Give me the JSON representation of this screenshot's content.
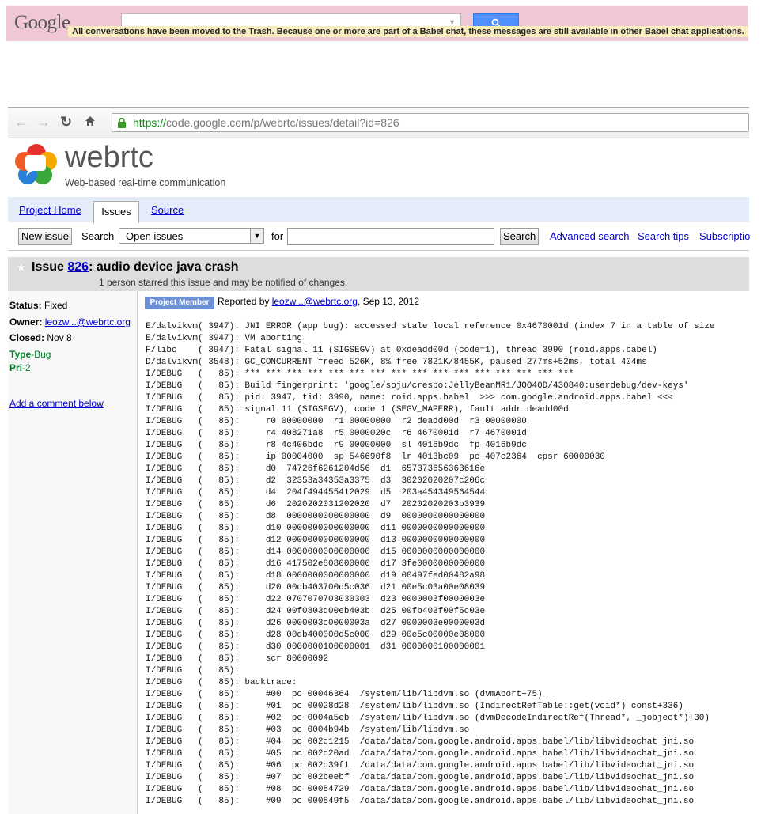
{
  "gmail": {
    "logo": "Google",
    "notice": "All conversations have been moved to the Trash. Because one or more are part of a Babel chat, these messages are still available in other Babel chat applications."
  },
  "browser": {
    "url_scheme": "https://",
    "url_rest": "code.google.com/p/webrtc/issues/detail?id=826"
  },
  "project": {
    "name": "webrtc",
    "summary": "Web-based real-time communication"
  },
  "tabs": [
    "Project Home",
    "Issues",
    "Source"
  ],
  "toolbar": {
    "new_issue": "New issue",
    "search_label": "Search",
    "select_value": "Open issues",
    "for_label": "for",
    "search_button": "Search",
    "advanced": "Advanced search",
    "tips": "Search tips",
    "subscriptions": "Subscriptio"
  },
  "issue": {
    "prefix": "Issue ",
    "number": "826",
    "title": ": audio device java crash",
    "stars_note": "1 person starred this issue and may be notified of changes."
  },
  "meta": {
    "status_label": "Status:",
    "status_value": "Fixed",
    "owner_label": "Owner:",
    "owner_value": "leozw...@webrtc.org",
    "closed_label": "Closed:",
    "closed_value": "Nov 8",
    "type_label": "Type",
    "type_value": "-Bug",
    "pri_label": "Pri",
    "pri_value": "-2",
    "add_comment": "Add a comment below"
  },
  "comment": {
    "badge": "Project Member",
    "reported_by": "Reported by ",
    "author": "leozw...@webrtc.org",
    "date": ", Sep 13, 2012"
  },
  "log_lines": [
    "E/dalvikvm( 3947): JNI ERROR (app bug): accessed stale local reference 0x4670001d (index 7 in a table of size",
    "E/dalvikvm( 3947): VM aborting",
    "F/libc    ( 3947): Fatal signal 11 (SIGSEGV) at 0xdeadd00d (code=1), thread 3990 (roid.apps.babel)",
    "D/dalvikvm( 3548): GC_CONCURRENT freed 526K, 8% free 7821K/8455K, paused 277ms+52ms, total 404ms",
    "I/DEBUG   (   85): *** *** *** *** *** *** *** *** *** *** *** *** *** *** *** ***",
    "I/DEBUG   (   85): Build fingerprint: 'google/soju/crespo:JellyBeanMR1/JOO40D/430840:userdebug/dev-keys'",
    "I/DEBUG   (   85): pid: 3947, tid: 3990, name: roid.apps.babel  >>> com.google.android.apps.babel <<<",
    "I/DEBUG   (   85): signal 11 (SIGSEGV), code 1 (SEGV_MAPERR), fault addr deadd00d",
    "I/DEBUG   (   85):     r0 00000000  r1 00000000  r2 deadd00d  r3 00000000",
    "I/DEBUG   (   85):     r4 408271a8  r5 0000020c  r6 4670001d  r7 4670001d",
    "I/DEBUG   (   85):     r8 4c406bdc  r9 00000000  sl 4016b9dc  fp 4016b9dc",
    "I/DEBUG   (   85):     ip 00004000  sp 546690f8  lr 4013bc09  pc 407c2364  cpsr 60000030",
    "I/DEBUG   (   85):     d0  74726f6261204d56  d1  657373656363616e",
    "I/DEBUG   (   85):     d2  32353a34353a3375  d3  30202020207c206c",
    "I/DEBUG   (   85):     d4  204f494455412029  d5  203a454349564544",
    "I/DEBUG   (   85):     d6  2020202031202020  d7  20202020203b3939",
    "I/DEBUG   (   85):     d8  0000000000000000  d9  0000000000000000",
    "I/DEBUG   (   85):     d10 0000000000000000  d11 0000000000000000",
    "I/DEBUG   (   85):     d12 0000000000000000  d13 0000000000000000",
    "I/DEBUG   (   85):     d14 0000000000000000  d15 0000000000000000",
    "I/DEBUG   (   85):     d16 417502e808000000  d17 3fe0000000000000",
    "I/DEBUG   (   85):     d18 0000000000000000  d19 00497fed00482a98",
    "I/DEBUG   (   85):     d20 00db403700d5c036  d21 00e5c03a00e08039",
    "I/DEBUG   (   85):     d22 0707070703030303  d23 0000003f0000003e",
    "I/DEBUG   (   85):     d24 00f0803d00eb403b  d25 00fb403f00f5c03e",
    "I/DEBUG   (   85):     d26 0000003c0000003a  d27 0000003e0000003d",
    "I/DEBUG   (   85):     d28 00db400000d5c000  d29 00e5c00000e08000",
    "I/DEBUG   (   85):     d30 0000000100000001  d31 0000000100000001",
    "I/DEBUG   (   85):     scr 80000092",
    "I/DEBUG   (   85):",
    "I/DEBUG   (   85): backtrace:",
    "I/DEBUG   (   85):     #00  pc 00046364  /system/lib/libdvm.so (dvmAbort+75)",
    "I/DEBUG   (   85):     #01  pc 00028d28  /system/lib/libdvm.so (IndirectRefTable::get(void*) const+336)",
    "I/DEBUG   (   85):     #02  pc 0004a5eb  /system/lib/libdvm.so (dvmDecodeIndirectRef(Thread*, _jobject*)+30)",
    "I/DEBUG   (   85):     #03  pc 0004b94b  /system/lib/libdvm.so",
    "I/DEBUG   (   85):     #04  pc 002d1215  /data/data/com.google.android.apps.babel/lib/libvideochat_jni.so",
    "I/DEBUG   (   85):     #05  pc 002d20ad  /data/data/com.google.android.apps.babel/lib/libvideochat_jni.so",
    "I/DEBUG   (   85):     #06  pc 002d39f1  /data/data/com.google.android.apps.babel/lib/libvideochat_jni.so",
    "I/DEBUG   (   85):     #07  pc 002beebf  /data/data/com.google.android.apps.babel/lib/libvideochat_jni.so",
    "I/DEBUG   (   85):     #08  pc 00084729  /data/data/com.google.android.apps.babel/lib/libvideochat_jni.so",
    "I/DEBUG   (   85):     #09  pc 000849f5  /data/data/com.google.android.apps.babel/lib/libvideochat_jni.so"
  ],
  "colors": {
    "gbar": "#f0c8d4",
    "notice_bg": "#f9edbe",
    "tabbar": "#e5ecf9",
    "link": "#0000cc",
    "type_green": "#00802b",
    "badge": "#6e8fd4"
  }
}
